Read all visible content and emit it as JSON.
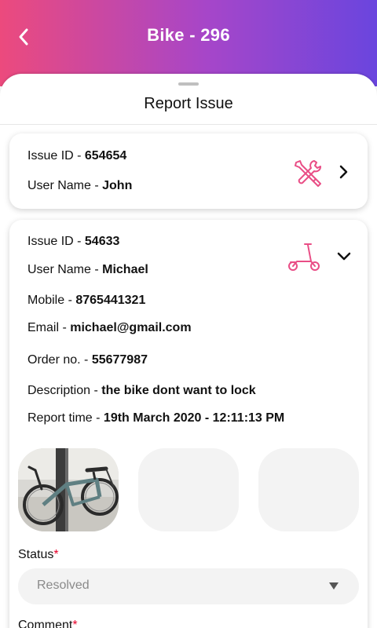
{
  "header": {
    "title": "Bike - 296",
    "back_icon": "chevron-left-icon"
  },
  "sheet": {
    "title": "Report Issue"
  },
  "issues": [
    {
      "issue_id_label": "Issue ID - ",
      "issue_id": "654654",
      "user_name_label": "User Name - ",
      "user_name": "John",
      "icon": "tools-icon",
      "toggle_icon": "chevron-right-icon"
    },
    {
      "issue_id_label": "Issue ID - ",
      "issue_id": "54633",
      "user_name_label": "User Name - ",
      "user_name": "Michael",
      "mobile_label": "Mobile - ",
      "mobile": "8765441321",
      "email_label": "Email - ",
      "email": "michael@gmail.com",
      "order_label": "Order no. - ",
      "order": "55677987",
      "description_label": "Description - ",
      "description": "the bike dont want to lock",
      "report_time_label": "Report time - ",
      "report_time": "19th March 2020 - 12:11:13 PM",
      "icon": "scooter-icon",
      "toggle_icon": "chevron-down-icon"
    }
  ],
  "status": {
    "label": "Status",
    "required_mark": "*",
    "value": "Resolved"
  },
  "comment": {
    "label": "Comment",
    "required_mark": "*"
  },
  "colors": {
    "accent": "#e94e86",
    "gradient_start": "#ec4a7d",
    "gradient_end": "#6a45de",
    "required": "#e8002a"
  }
}
